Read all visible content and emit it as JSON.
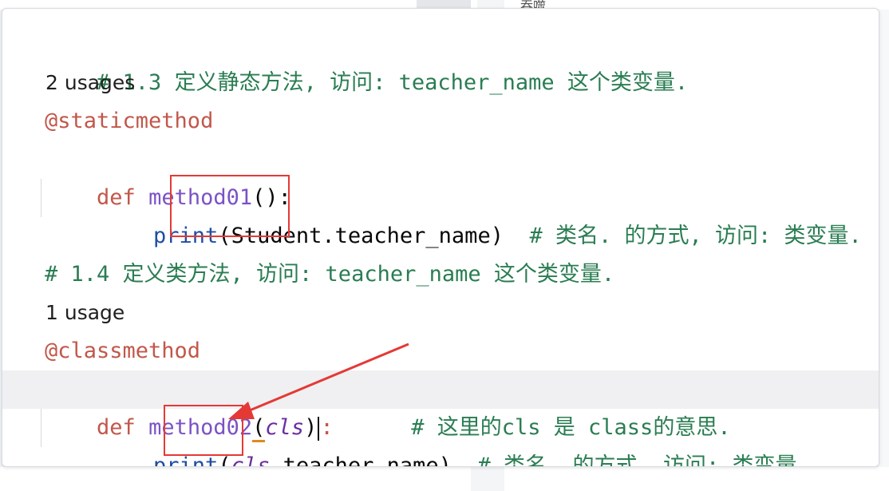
{
  "background": {
    "tab_text": "吞噬"
  },
  "code": {
    "comment_1": "# 1.3 定义静态方法, 访问: teacher_name 这个类变量.",
    "usages_1": "2 usages",
    "decorator_1": "@staticmethod",
    "def_kw_1": "def",
    "func_1": "method01",
    "sig_1": "():",
    "print_1": "print",
    "paren_open_1": "(",
    "class_ref": "Student",
    "attr_1": ".teacher_name)",
    "trailing_comment_1": "# 类名. 的方式, 访问: 类变量.",
    "comment_2": "# 1.4 定义类方法, 访问: teacher_name 这个类变量.",
    "usages_2": "1 usage",
    "decorator_2": "@classmethod",
    "def_kw_2": "def",
    "func_2": "method02",
    "paren_open_2": "(",
    "param_cls": "cls",
    "paren_close_2": ")",
    "colon_2": ":",
    "trailing_comment_2": "# 这里的cls 是 class的意思.",
    "print_2": "print",
    "paren_open_3": "(",
    "cls_ref": "cls",
    "attr_2": ".teacher_name)",
    "trailing_comment_3": "# 类名. 的方式, 访问: 类变量."
  },
  "colors": {
    "comment": "#2a7d52",
    "keyword": "#c2574a",
    "function": "#7b52c5",
    "builtin": "#1f4ea3",
    "highlight_box": "#e53935"
  }
}
